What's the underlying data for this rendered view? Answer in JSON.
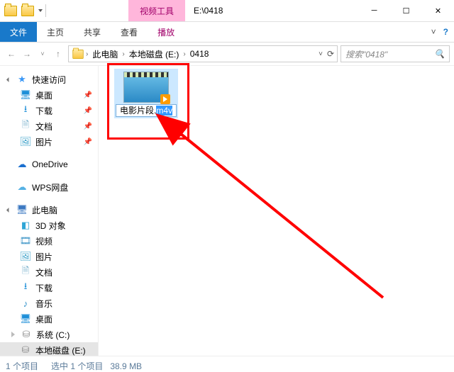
{
  "title": "E:\\0418",
  "context_tab": "视频工具",
  "ribbon": {
    "file": "文件",
    "home": "主页",
    "share": "共享",
    "view": "查看",
    "play": "播放"
  },
  "address": {
    "root": "此电脑",
    "drive": "本地磁盘 (E:)",
    "folder": "0418"
  },
  "search_placeholder": "搜索\"0418\"",
  "nav": {
    "quick": "快速访问",
    "desktop": "桌面",
    "downloads": "下载",
    "documents": "文档",
    "pictures": "图片",
    "onedrive": "OneDrive",
    "wps": "WPS网盘",
    "thispc": "此电脑",
    "obj3d": "3D 对象",
    "videos": "视频",
    "pictures2": "图片",
    "documents2": "文档",
    "downloads2": "下载",
    "music": "音乐",
    "desktop2": "桌面",
    "drive_c": "系统 (C:)",
    "drive_e": "本地磁盘 (E:)"
  },
  "file": {
    "name_part1": "电影片段.",
    "name_ext": "m4v"
  },
  "status": {
    "count": "1 个项目",
    "selection": "选中 1 个项目",
    "size": "38.9 MB"
  }
}
